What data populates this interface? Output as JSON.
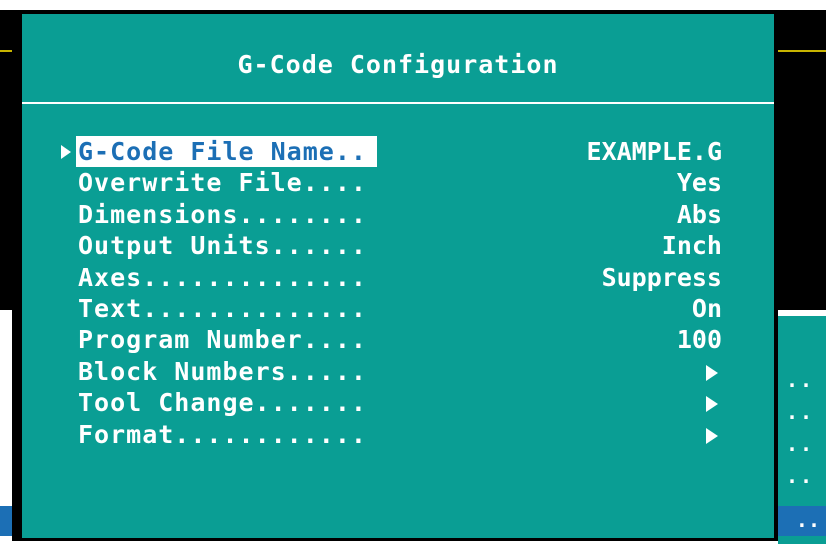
{
  "dialog": {
    "title": "G-Code Configuration"
  },
  "menu": {
    "items": [
      {
        "label": "G-Code File Name..",
        "value": "EXAMPLE.G",
        "selected": true
      },
      {
        "label": "Overwrite File....",
        "value": "Yes"
      },
      {
        "label": "Dimensions........",
        "value": "Abs"
      },
      {
        "label": "Output Units......",
        "value": "Inch"
      },
      {
        "label": "Axes..............",
        "value": "Suppress"
      },
      {
        "label": "Text..............",
        "value": "On"
      },
      {
        "label": "Program Number....",
        "value": "100"
      },
      {
        "label": "Block Numbers.....",
        "value": "",
        "submenu": true
      },
      {
        "label": "Tool Change.......",
        "value": "",
        "submenu": true
      },
      {
        "label": "Format............",
        "value": "",
        "submenu": true
      }
    ]
  },
  "background": {
    "ellipsis": ".."
  },
  "colors": {
    "dialog_bg": "#0a9e94",
    "selection_bg": "#ffffff",
    "selection_text": "#1c6fb5",
    "text": "#ffffff"
  },
  "icons": {
    "cursor": "selection-cursor-icon",
    "submenu": "submenu-arrow-icon"
  }
}
